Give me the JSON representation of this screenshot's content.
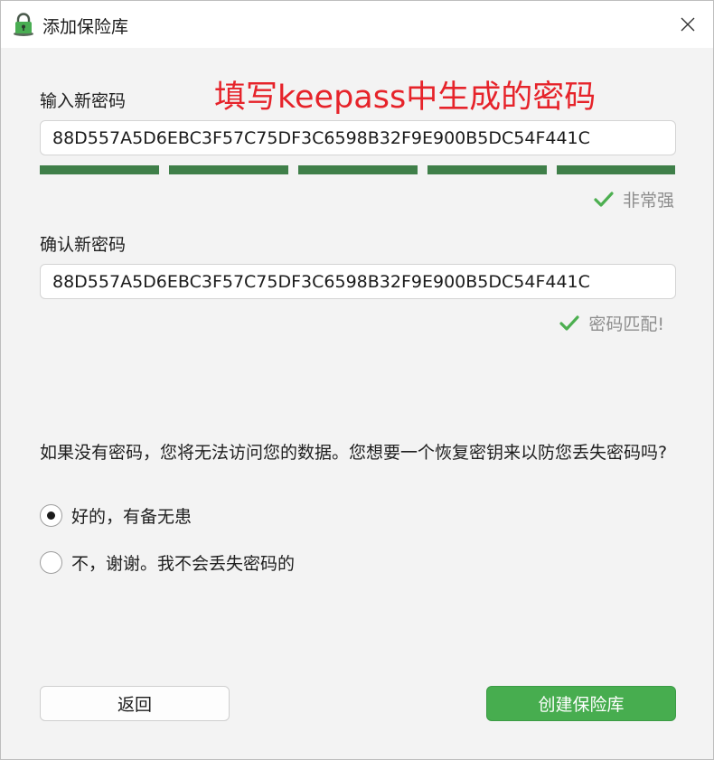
{
  "window": {
    "title": "添加保险库",
    "app_icon": "vault-lock-icon",
    "close_icon": "close-icon"
  },
  "annotation": "填写keepass中生成的密码",
  "new_password": {
    "label": "输入新密码",
    "value": "88D557A5D6EBC3F57C75DF3C6598B32F9E900B5DC54F441C",
    "strength_segments_filled": 5,
    "strength_segments_total": 5,
    "strength_text": "非常强",
    "strength_icon": "check-icon"
  },
  "confirm_password": {
    "label": "确认新密码",
    "value": "88D557A5D6EBC3F57C75DF3C6598B32F9E900B5DC54F441C",
    "match_text": "密码匹配!",
    "match_icon": "check-icon"
  },
  "recovery": {
    "question": "如果没有密码，您将无法访问您的数据。您想要一个恢复密钥来以防您丢失密码吗?",
    "options": [
      {
        "label": "好的，有备无患",
        "selected": true
      },
      {
        "label": "不，谢谢。我不会丢失密码的",
        "selected": false
      }
    ]
  },
  "buttons": {
    "back": "返回",
    "create": "创建保险库"
  },
  "colors": {
    "strength_bar": "#3f7f49",
    "check": "#4caf50",
    "primary_button": "#47ad4f",
    "annotation": "#e6232a"
  }
}
